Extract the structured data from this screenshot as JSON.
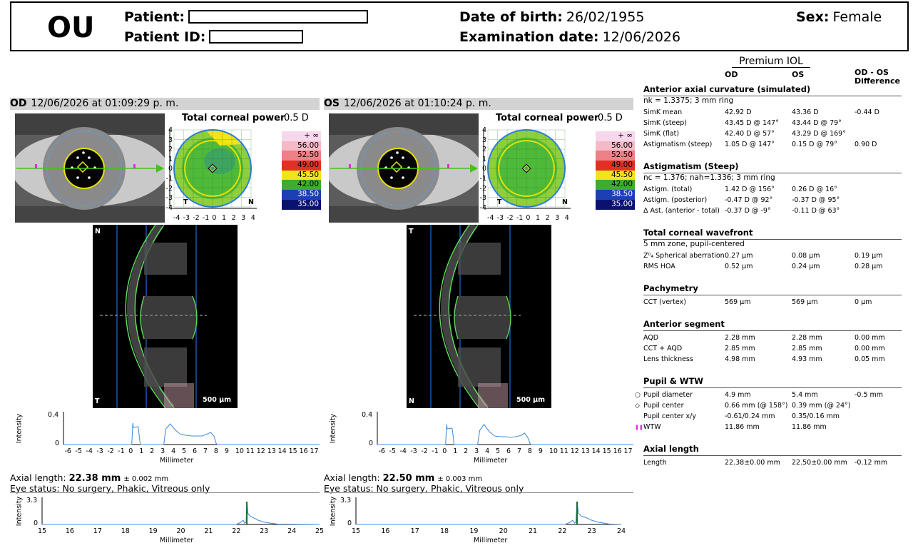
{
  "header": {
    "eye": "OU",
    "patient_label": "Patient:",
    "patient_id_label": "Patient ID:",
    "dob_label": "Date of birth:",
    "dob": "26/02/1955",
    "exam_label": "Examination date:",
    "exam_date": "12/06/2026",
    "sex_label": "Sex:",
    "sex": "Female"
  },
  "od": {
    "eye": "OD",
    "timestamp": "12/06/2026 at 01:09:29 p. m.",
    "map_title": "Total corneal power",
    "map_step": "0.5 D",
    "axial_label": "Axial length:",
    "axial_value": "22.38 mm",
    "axial_tol": "± 0.002 mm",
    "status": "Eye status: No surgery, Phakic, Vitreous only",
    "scale_bar": "500 µm"
  },
  "os": {
    "eye": "OS",
    "timestamp": "12/06/2026 at 01:10:24 p. m.",
    "map_title": "Total corneal power",
    "map_step": "0.5 D",
    "axial_label": "Axial length:",
    "axial_value": "22.50 mm",
    "axial_tol": "± 0.003 mm",
    "status": "Eye status: No surgery, Phakic, Vitreous only",
    "scale_bar": "500 µm"
  },
  "colors": {
    "panel_bar": "#d3d3d3",
    "profile": "#4a8fd8",
    "peak": "#1f6b2f",
    "arrow": "#44c21a",
    "ring": "#e8e000"
  },
  "color_scale": [
    "+ ∞",
    "56.00",
    "52.50",
    "49.00",
    "45.50",
    "42.00",
    "38.50",
    "35.00"
  ],
  "map_axis": {
    "y": [
      "4",
      "3",
      "2",
      "1",
      "0",
      "-1",
      "-2",
      "-3",
      "-4"
    ],
    "x": [
      "-4",
      "-3",
      "-2",
      "-1",
      "0",
      "1",
      "2",
      "3",
      "4"
    ],
    "left_marker": "T",
    "right_marker": "N"
  },
  "scheimpflug_markers": {
    "top": "N",
    "bottom": "T",
    "os_top": "T",
    "os_bottom": "N"
  },
  "profile_axis": {
    "ylabel": "Intensity",
    "xlabel": "Millimeter",
    "yticks": [
      "0.4",
      "0"
    ],
    "xticks": [
      "-6",
      "-5",
      "-4",
      "-3",
      "-2",
      "-1",
      "0",
      "1",
      "2",
      "3",
      "4",
      "5",
      "6",
      "7",
      "8",
      "9",
      "10",
      "11",
      "12",
      "13",
      "14",
      "15",
      "16",
      "17"
    ]
  },
  "axial_axis": {
    "ylabel": "Intensity",
    "xlabel": "Millimeter",
    "yticks": [
      "3.3",
      "0"
    ],
    "xticks": [
      "15",
      "16",
      "17",
      "18",
      "19",
      "20",
      "21",
      "22",
      "23",
      "24",
      "25"
    ]
  },
  "chart_data": [
    {
      "type": "line",
      "name": "OD A-scan intensity",
      "xlabel": "Millimeter",
      "ylabel": "Intensity",
      "xlim": [
        -6.5,
        17.5
      ],
      "ylim": [
        0,
        0.4
      ],
      "x": [
        -6.5,
        -0.1,
        0.0,
        0.05,
        0.5,
        0.55,
        0.7,
        2.9,
        3.1,
        3.5,
        4.0,
        4.5,
        5.0,
        5.5,
        6.0,
        6.5,
        7.0,
        7.3,
        7.6,
        7.8,
        7.9,
        17.5
      ],
      "y": [
        0,
        0,
        0.3,
        0.24,
        0.25,
        0.18,
        0,
        0,
        0.22,
        0.29,
        0.2,
        0.14,
        0.13,
        0.12,
        0.12,
        0.12,
        0.15,
        0.17,
        0.12,
        0.02,
        0,
        0
      ]
    },
    {
      "type": "line",
      "name": "OS A-scan intensity",
      "xlabel": "Millimeter",
      "ylabel": "Intensity",
      "xlim": [
        -6.5,
        17.5
      ],
      "ylim": [
        0,
        0.4
      ],
      "x": [
        -6.5,
        -0.1,
        0.0,
        0.05,
        0.5,
        0.55,
        0.7,
        2.9,
        3.1,
        3.5,
        4.0,
        4.5,
        5.0,
        5.5,
        6.0,
        6.5,
        7.0,
        7.3,
        7.6,
        7.8,
        7.9,
        17.5
      ],
      "y": [
        0,
        0,
        0.28,
        0.22,
        0.23,
        0.18,
        0,
        0,
        0.2,
        0.28,
        0.18,
        0.12,
        0.11,
        0.11,
        0.1,
        0.11,
        0.13,
        0.16,
        0.1,
        0.02,
        0,
        0
      ]
    },
    {
      "type": "line",
      "name": "OD axial length scan",
      "xlabel": "Millimeter",
      "ylabel": "Intensity",
      "xlim": [
        15,
        25
      ],
      "ylim": [
        0,
        3.3
      ],
      "x": [
        15,
        22.0,
        22.15,
        22.25,
        22.3,
        22.35,
        22.38,
        22.42,
        22.5,
        22.6,
        22.8,
        23.0,
        23.2,
        23.5,
        25
      ],
      "y": [
        0,
        0,
        0.3,
        0.6,
        0.2,
        0.3,
        3.3,
        1.6,
        1.2,
        1.0,
        0.6,
        0.35,
        0.2,
        0.05,
        0
      ]
    },
    {
      "type": "line",
      "name": "OS axial length scan",
      "xlabel": "Millimeter",
      "ylabel": "Intensity",
      "xlim": [
        15,
        24
      ],
      "ylim": [
        0,
        3.3
      ],
      "x": [
        15,
        22.1,
        22.25,
        22.35,
        22.42,
        22.46,
        22.5,
        22.55,
        22.65,
        22.8,
        23.0,
        23.2,
        23.4,
        23.6,
        24
      ],
      "y": [
        0,
        0,
        0.3,
        0.6,
        0.2,
        0.3,
        3.3,
        1.6,
        1.2,
        1.0,
        0.6,
        0.35,
        0.2,
        0.05,
        0
      ]
    }
  ],
  "table": {
    "title": "Premium IOL",
    "col_od": "OD",
    "col_os": "OS",
    "col_diff": "OD - OS Difference",
    "sections": [
      {
        "title": "Anterior axial curvature (simulated)",
        "subtitle": "nk = 1.3375; 3 mm ring",
        "rows": [
          [
            "SimK mean",
            "42.92 D",
            "43.36 D",
            "-0.44 D"
          ],
          [
            "SimK (steep)",
            "43.45 D @ 147°",
            "43.44 D @ 79°",
            ""
          ],
          [
            "SimK (flat)",
            "42.40 D @ 57°",
            "43.29 D @ 169°",
            ""
          ],
          [
            "Astigmatism (steep)",
            "1.05 D @ 147°",
            "0.15 D @ 79°",
            "0.90 D"
          ]
        ]
      },
      {
        "title": "Astigmatism (Steep)",
        "subtitle": "nc = 1.376; nah=1.336; 3 mm ring",
        "rows": [
          [
            "Astigm. (total)",
            "1.42 D @ 156°",
            "0.26 D @ 16°",
            ""
          ],
          [
            "Astigm. (posterior)",
            "-0.47 D @ 92°",
            "-0.37 D @ 95°",
            ""
          ],
          [
            "Δ Ast. (anterior - total)",
            "-0.37 D @ -9°",
            "-0.11 D @ 63°",
            ""
          ]
        ]
      },
      {
        "title": "Total corneal wavefront",
        "subtitle": "5 mm zone, pupil-centered",
        "rows": [
          [
            "Z⁰₄ Spherical aberration",
            "0.27 µm",
            "0.08 µm",
            "0.19 µm"
          ],
          [
            "RMS HOA",
            "0.52 µm",
            "0.24 µm",
            "0.28 µm"
          ]
        ]
      },
      {
        "title": "Pachymetry",
        "subtitle": "",
        "rows": [
          [
            "CCT (vertex)",
            "569 µm",
            "569 µm",
            "0 µm"
          ]
        ]
      },
      {
        "title": "Anterior segment",
        "subtitle": "",
        "rows": [
          [
            "AQD",
            "2.28 mm",
            "2.28 mm",
            "0.00 mm"
          ],
          [
            "CCT + AQD",
            "2.85 mm",
            "2.85 mm",
            "0.00 mm"
          ],
          [
            "Lens thickness",
            "4.98 mm",
            "4.93 mm",
            "0.05 mm"
          ]
        ]
      },
      {
        "title": "Pupil & WTW",
        "subtitle": "",
        "rows": [
          [
            "Pupil diameter",
            "4.9 mm",
            "5.4 mm",
            "-0.5 mm"
          ],
          [
            "Pupil center",
            "0.66 mm (@ 158°)",
            "0.39 mm (@ 24°)",
            ""
          ],
          [
            "Pupil center x/y",
            "-0.61/0.24 mm",
            "0.35/0.16 mm",
            ""
          ],
          [
            "WTW",
            "11.86 mm",
            "11.86 mm",
            ""
          ]
        ]
      },
      {
        "title": "Axial length",
        "subtitle": "",
        "rows": [
          [
            "Length",
            "22.38±0.00 mm",
            "22.50±0.00 mm",
            "-0.12 mm"
          ]
        ]
      }
    ]
  }
}
